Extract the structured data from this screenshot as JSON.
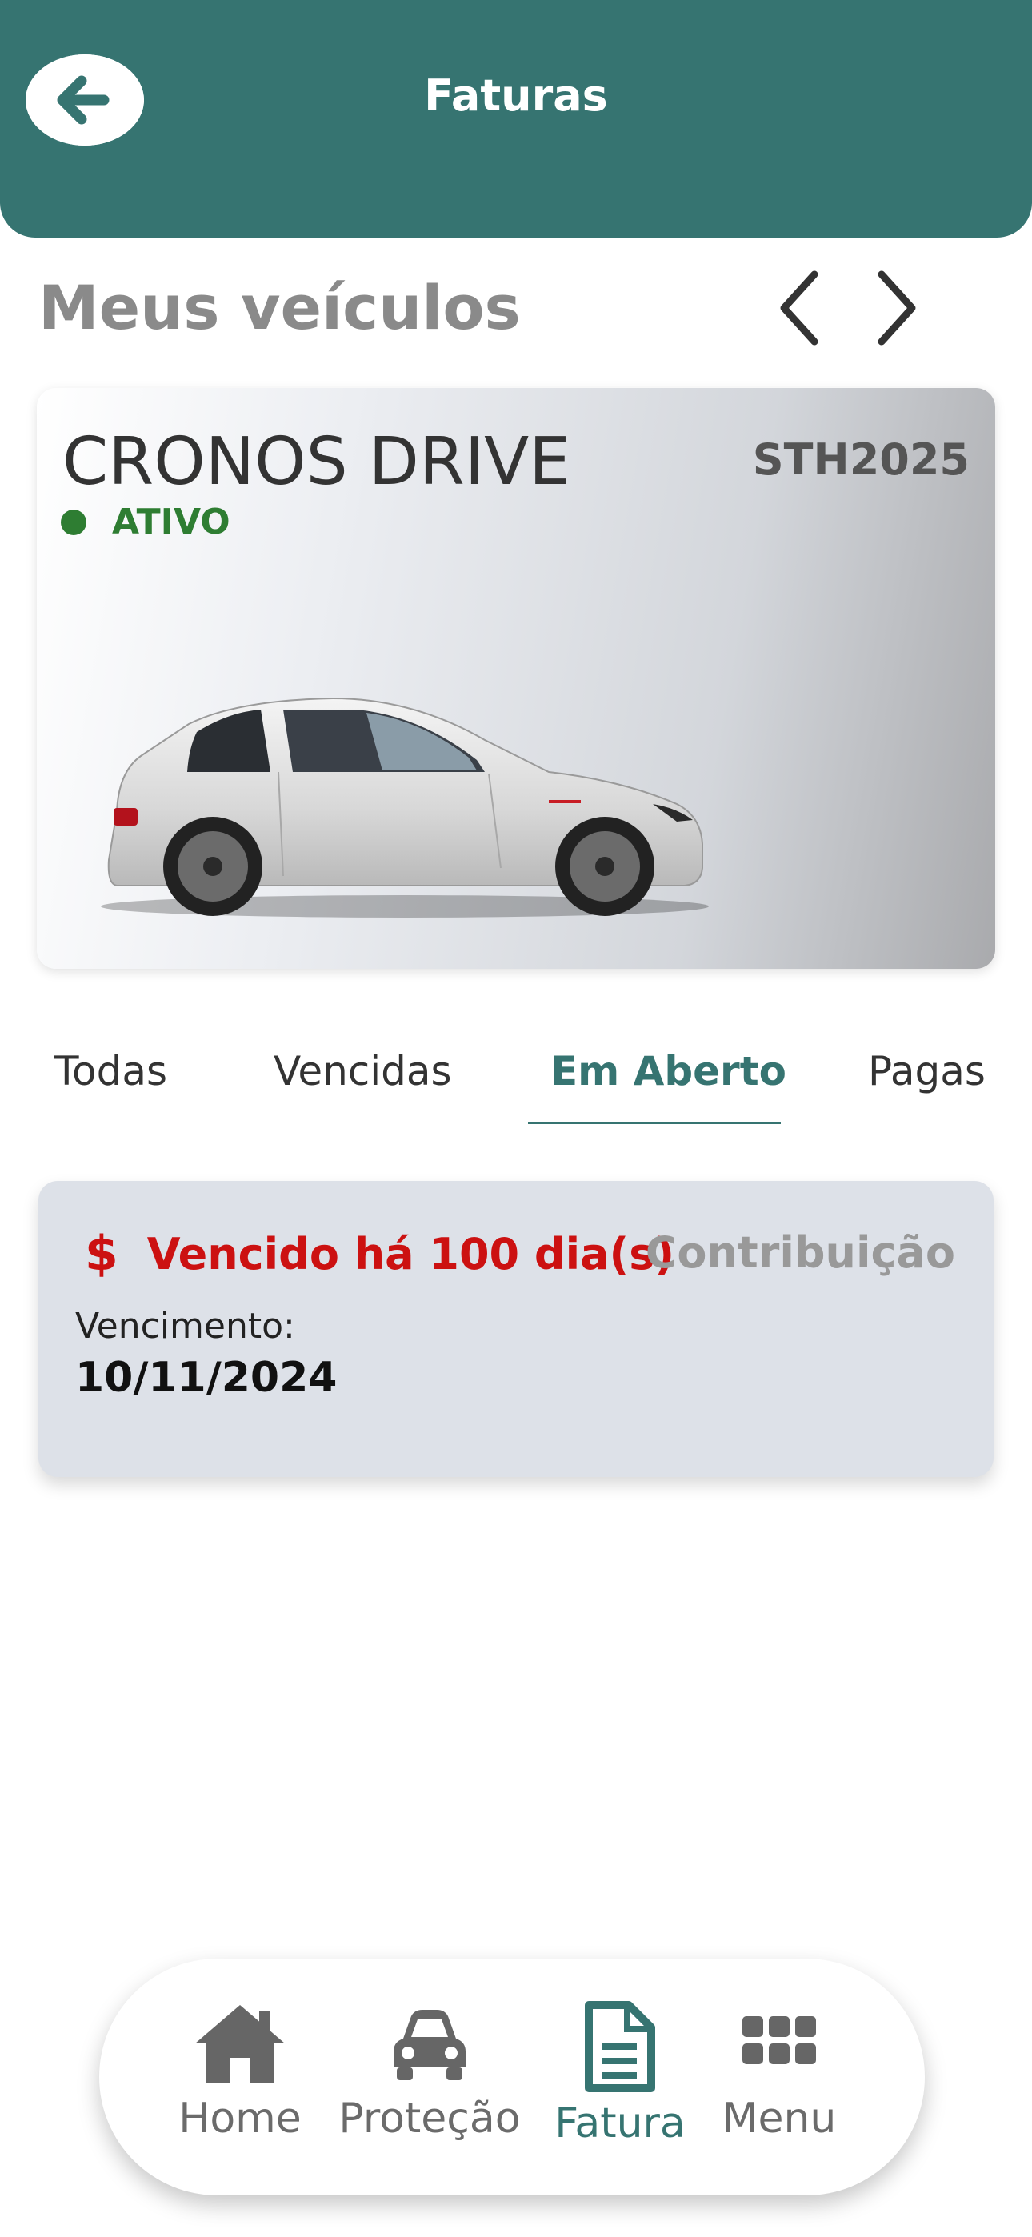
{
  "header": {
    "title": "Faturas",
    "back_icon": "arrow-left-icon"
  },
  "vehicles": {
    "title": "Meus veículos",
    "prev_icon": "chevron-left-icon",
    "next_icon": "chevron-right-icon",
    "card": {
      "name": "CRONOS DRIVE",
      "plate": "STH2025",
      "status": "ATIVO",
      "status_color": "#2e7d32"
    }
  },
  "tabs": [
    {
      "label": "Todas",
      "active": false
    },
    {
      "label": "Vencidas",
      "active": false
    },
    {
      "label": "Em Aberto",
      "active": true
    },
    {
      "label": "Pagas",
      "active": false
    }
  ],
  "invoice": {
    "currency_icon": "$",
    "status_text": "Vencido há 100 dia(s)",
    "type": "Contribuição",
    "due_label": "Vencimento:",
    "due_date": "10/11/2024",
    "status_color": "#cc1111"
  },
  "bottom_nav": [
    {
      "label": "Home",
      "icon": "home-icon",
      "active": false
    },
    {
      "label": "Proteção",
      "icon": "car-icon",
      "active": false
    },
    {
      "label": "Fatura",
      "icon": "document-icon",
      "active": true
    },
    {
      "label": "Menu",
      "icon": "grid-icon",
      "active": false
    }
  ],
  "colors": {
    "primary": "#367471",
    "danger": "#cc1111",
    "success": "#2e7d32"
  }
}
